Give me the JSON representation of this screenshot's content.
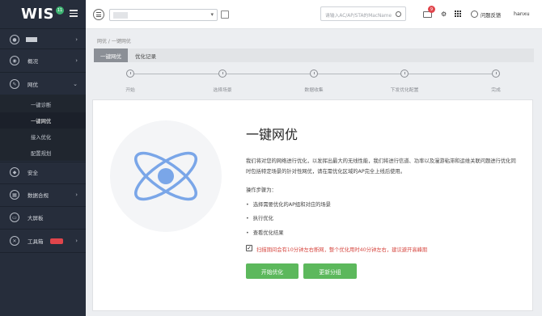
{
  "app": {
    "logo": "WIS",
    "logo_badge": "11"
  },
  "sidebar": {
    "items": [
      {
        "label": "概况"
      },
      {
        "label": "网优"
      },
      {
        "label": "安全"
      },
      {
        "label": "数据合规"
      },
      {
        "label": "大屏板"
      },
      {
        "label": "工具箱"
      }
    ],
    "subitems": [
      {
        "label": "一键诊断"
      },
      {
        "label": "一键网优"
      },
      {
        "label": "接入优化"
      },
      {
        "label": "配置规划"
      }
    ]
  },
  "topbar": {
    "search_placeholder": "请输入AC/AP/STA的MacName",
    "mail_count": "9",
    "help_label": "问题反馈",
    "user": "hanxu"
  },
  "breadcrumb": "网优 / 一键网优",
  "tabs": [
    {
      "label": "一键网优"
    },
    {
      "label": "优化记录"
    }
  ],
  "steps": [
    "开始",
    "选择场景",
    "数据收集",
    "下发优化配置",
    "完成"
  ],
  "card": {
    "title": "一键网优",
    "description": "我们将对您的网络进行优化，以发挥出最大的无线性能，我们将进行信道、功率以及漫游粘滞和运维关联问题进行优化同时包括特定场景的针对性网优，请在需优化区域的AP完全上线后使用。",
    "steps_title": "操作步骤为：",
    "step_items": [
      "选择需要优化的AP组和对应的场景",
      "执行优化",
      "查看优化结果"
    ],
    "warning": "扫描期间会有10分钟左右断网，整个优化用时40分钟左右，建议避开高峰期",
    "start_button": "开始优化",
    "update_button": "更新分组"
  },
  "colors": {
    "primary_button": "#5cb85c",
    "sidebar_bg": "#262d3b",
    "warning": "#d74a43",
    "icon_blue": "#7aa6e8"
  },
  "icons": {
    "hero": "atom-icon"
  }
}
